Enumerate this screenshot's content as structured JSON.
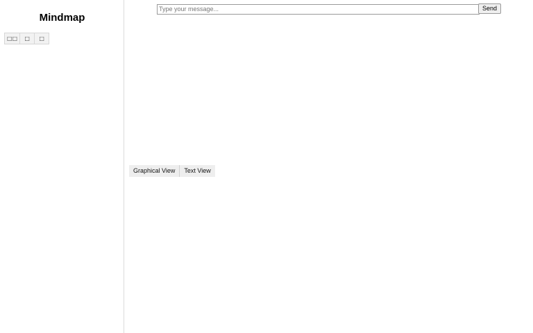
{
  "sidebar": {
    "title": "Mindmap",
    "tools": [
      {
        "label": "□□",
        "icon": "expand-icon"
      },
      {
        "label": "□",
        "icon": "box-icon"
      },
      {
        "label": "□",
        "icon": "box-icon"
      }
    ]
  },
  "chat": {
    "placeholder": "Type your message...",
    "value": "",
    "send_label": "Send"
  },
  "views": {
    "tabs": [
      {
        "label": "Graphical View"
      },
      {
        "label": "Text View"
      }
    ]
  }
}
